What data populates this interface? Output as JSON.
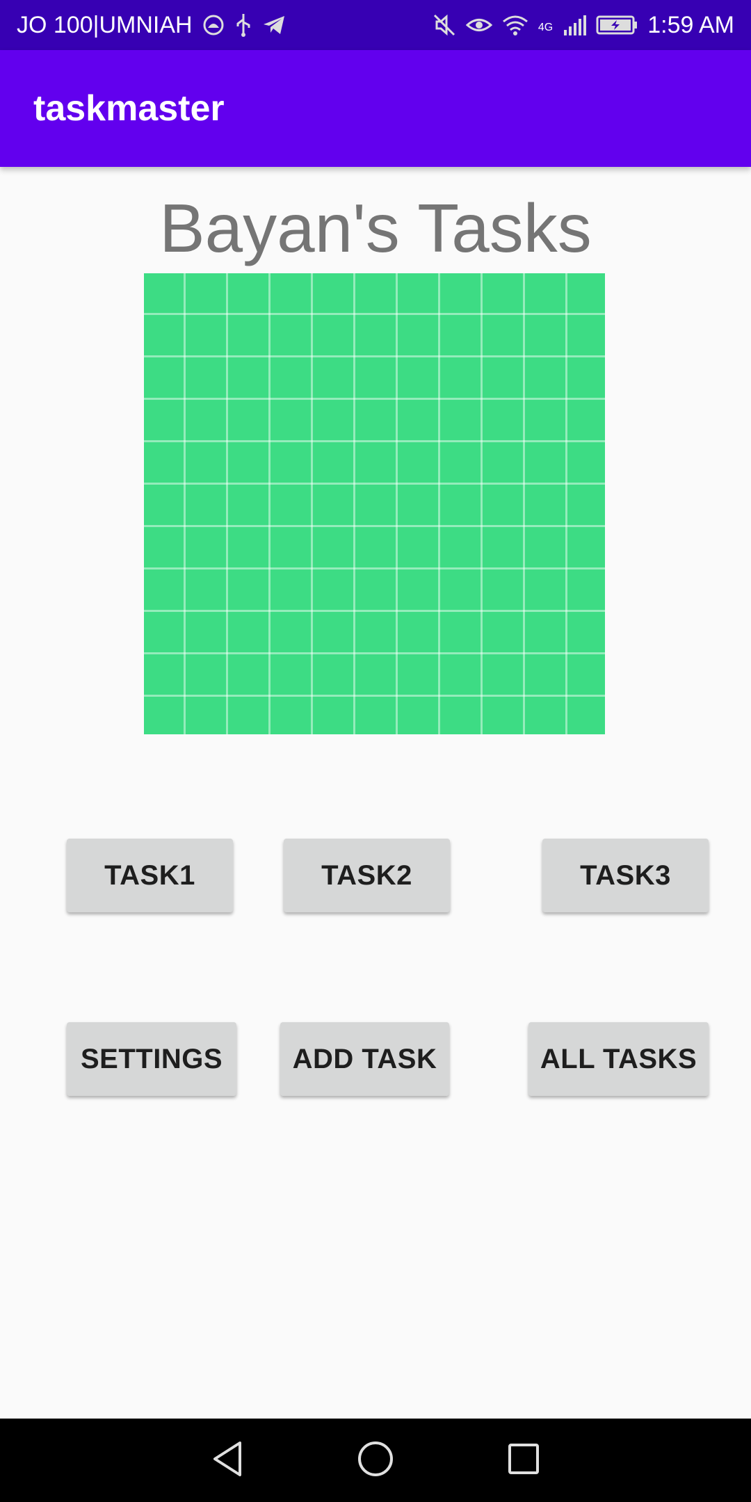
{
  "status_bar": {
    "carrier": "JO 100|UMNIAH",
    "network": "4G",
    "time": "1:59 AM",
    "icons": [
      "carrier-app-icon",
      "usb-icon",
      "telegram-icon",
      "mute-icon",
      "eye-comfort-icon",
      "wifi-icon",
      "signal-icon",
      "battery-charging-icon"
    ]
  },
  "app_bar": {
    "title": "taskmaster"
  },
  "main": {
    "heading": "Bayan's Tasks",
    "image": {
      "icon": "android-default-grid-image",
      "color": "#3ddc84"
    },
    "buttons": {
      "task1": "TASK1",
      "task2": "TASK2",
      "task3": "TASK3",
      "settings": "SETTINGS",
      "add_task": "ADD TASK",
      "all_tasks": "ALL TASKS"
    }
  },
  "nav_bar": {
    "icons": [
      "back-icon",
      "home-icon",
      "recents-icon"
    ]
  },
  "colors": {
    "status_bar": "#3700b3",
    "app_bar": "#6200ee",
    "button_bg": "#d6d7d7",
    "heading_text": "#757575"
  }
}
